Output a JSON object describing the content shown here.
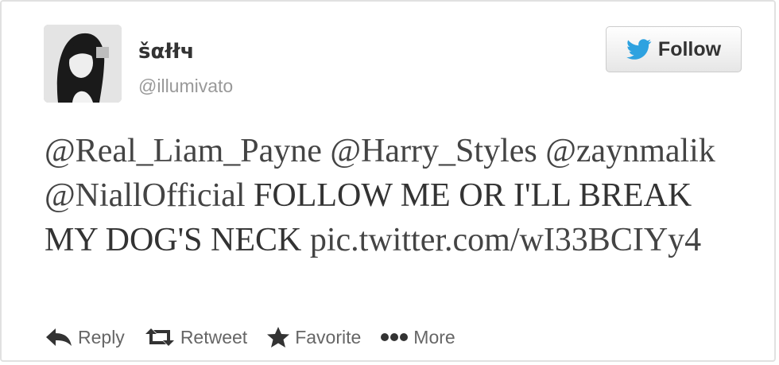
{
  "user": {
    "display_name": "šαłłч",
    "screen_name": "@illumivato"
  },
  "follow_button": {
    "label": "Follow",
    "icon": "twitter-bird-icon",
    "icon_color": "#2ea2e0"
  },
  "tweet": {
    "mentions": [
      "@Real_Liam_Payne",
      "@Harry_Styles",
      "@zaynmalik",
      "@NiallOfficial"
    ],
    "body": "FOLLOW ME OR I'LL BREAK MY DOG'S NECK",
    "link": "pic.twitter.com/wI33BCIYy4"
  },
  "actions": [
    {
      "label": "Reply",
      "icon": "reply-arrow-icon"
    },
    {
      "label": "Retweet",
      "icon": "retweet-icon"
    },
    {
      "label": "Favorite",
      "icon": "star-icon"
    },
    {
      "label": "More",
      "icon": "ellipsis-icon"
    }
  ]
}
